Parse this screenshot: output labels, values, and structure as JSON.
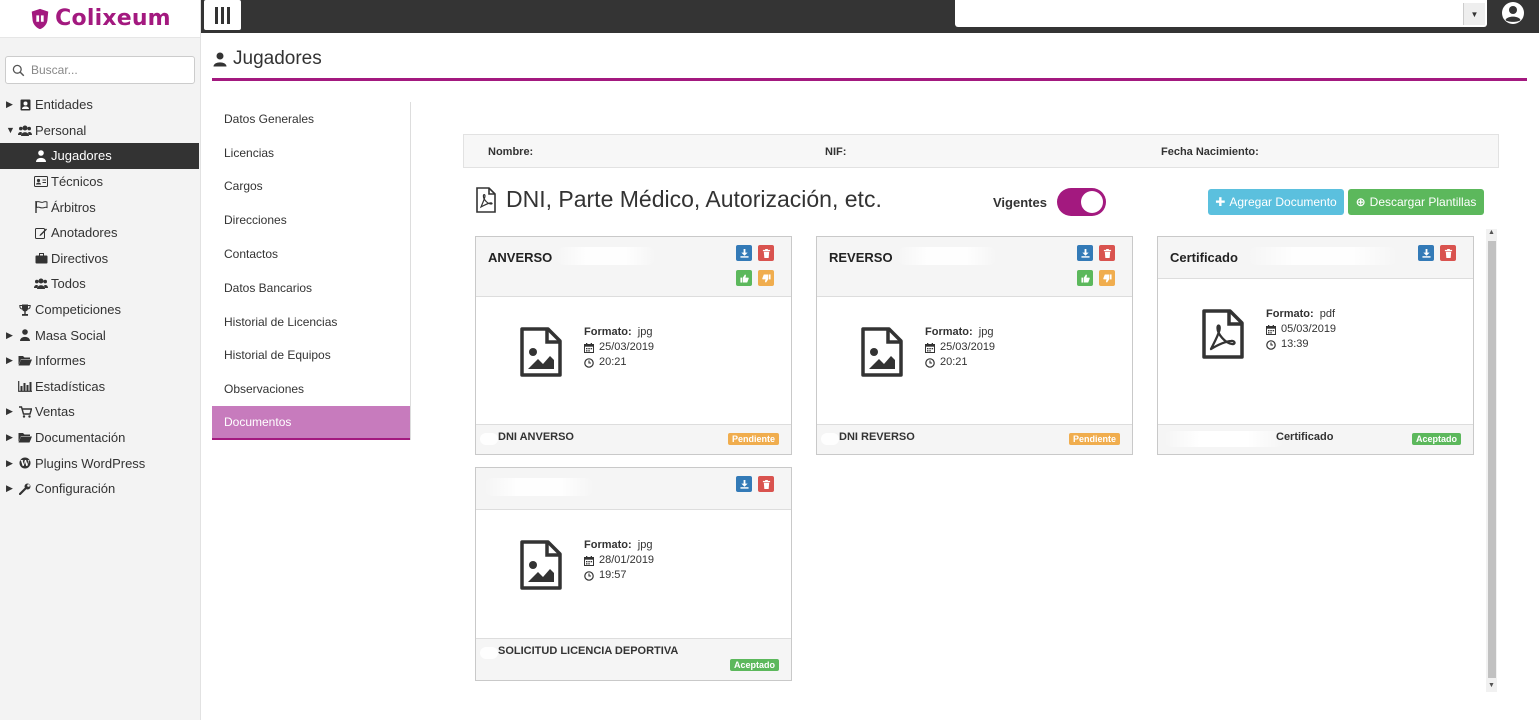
{
  "brand": {
    "name": "Colixeum",
    "color": "#a3197f"
  },
  "search": {
    "placeholder": "Buscar..."
  },
  "sidebar": {
    "items": [
      {
        "label": "Entidades",
        "icon": "address-card-icon",
        "caret": "right"
      },
      {
        "label": "Personal",
        "icon": "users-icon",
        "caret": "down"
      },
      {
        "label": "Jugadores",
        "icon": "user-icon",
        "sub": true,
        "active": true
      },
      {
        "label": "Técnicos",
        "icon": "id-card-icon",
        "sub": true
      },
      {
        "label": "Árbitros",
        "icon": "flag-icon",
        "sub": true
      },
      {
        "label": "Anotadores",
        "icon": "edit-icon",
        "sub": true
      },
      {
        "label": "Directivos",
        "icon": "briefcase-icon",
        "sub": true
      },
      {
        "label": "Todos",
        "icon": "users-icon",
        "sub": true
      },
      {
        "label": "Competiciones",
        "icon": "trophy-icon"
      },
      {
        "label": "Masa Social",
        "icon": "user-icon",
        "caret": "right"
      },
      {
        "label": "Informes",
        "icon": "folder-open-icon",
        "caret": "right"
      },
      {
        "label": "Estadísticas",
        "icon": "bar-chart-icon"
      },
      {
        "label": "Ventas",
        "icon": "shopping-cart-icon",
        "caret": "right"
      },
      {
        "label": "Documentación",
        "icon": "folder-open-icon",
        "caret": "right"
      },
      {
        "label": "Plugins WordPress",
        "icon": "wordpress-icon",
        "caret": "right"
      },
      {
        "label": "Configuración",
        "icon": "wrench-icon",
        "caret": "right"
      }
    ]
  },
  "page": {
    "title": "Jugadores"
  },
  "tabs": [
    {
      "label": "Datos Generales"
    },
    {
      "label": "Licencias"
    },
    {
      "label": "Cargos"
    },
    {
      "label": "Direcciones"
    },
    {
      "label": "Contactos"
    },
    {
      "label": "Datos Bancarios"
    },
    {
      "label": "Historial de Licencias"
    },
    {
      "label": "Historial de Equipos"
    },
    {
      "label": "Observaciones"
    },
    {
      "label": "Documentos",
      "active": true
    }
  ],
  "info": {
    "nombre": "Nombre:",
    "nif": "NIF:",
    "fecha": "Fecha Nacimiento:"
  },
  "docs": {
    "title": "DNI, Parte Médico, Autorización, etc.",
    "vigentes_label": "Vigentes",
    "vigentes_on": true,
    "add_label": "Agregar Documento",
    "download_label": "Descargar Plantillas"
  },
  "cards": [
    {
      "name": "ANVERSO",
      "format_label": "Formato:",
      "format": "jpg",
      "date": "25/03/2019",
      "time": "20:21",
      "file": "DNI ANVERSO",
      "status": "Pendiente"
    },
    {
      "name": "REVERSO",
      "format_label": "Formato:",
      "format": "jpg",
      "date": "25/03/2019",
      "time": "20:21",
      "file": "DNI REVERSO",
      "status": "Pendiente"
    },
    {
      "name": "Certificado",
      "format_label": "Formato:",
      "format": "pdf",
      "date": "05/03/2019",
      "time": "13:39",
      "file": "Certificado",
      "status": "Aceptado"
    },
    {
      "name": "",
      "format_label": "Formato:",
      "format": "jpg",
      "date": "28/01/2019",
      "time": "19:57",
      "file": "SOLICITUD LICENCIA DEPORTIVA",
      "status": "Aceptado"
    }
  ]
}
